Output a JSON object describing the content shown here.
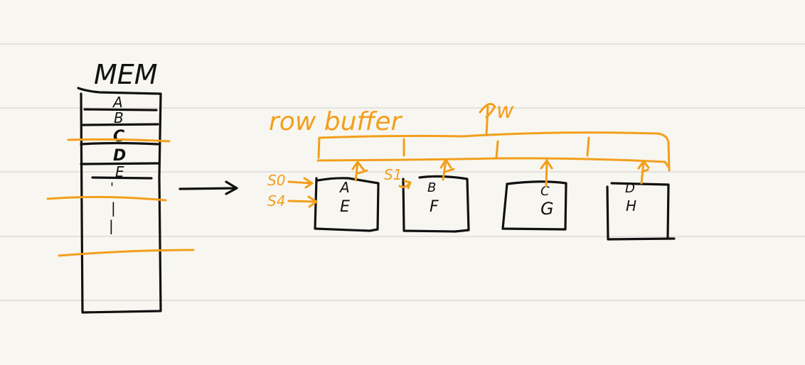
{
  "colors": {
    "paper": "#f8f6f0",
    "ink": "#111111",
    "highlight": "#f29f1c",
    "rule": "#d9d7d1"
  },
  "memory": {
    "title": "MEM",
    "cells": [
      "A",
      "B",
      "C",
      "D",
      "E"
    ],
    "continuation": [
      "'",
      "|",
      "|"
    ]
  },
  "row_buffer": {
    "label": "row buffer",
    "width_label": "w"
  },
  "banks": [
    {
      "top": "A",
      "bottom": "E"
    },
    {
      "top": "B",
      "bottom": "F"
    },
    {
      "top": "C",
      "bottom": "G"
    },
    {
      "top": "D",
      "bottom": "H"
    }
  ],
  "pointers": {
    "s0": "S0",
    "s4": "S4",
    "s1": "S1"
  }
}
